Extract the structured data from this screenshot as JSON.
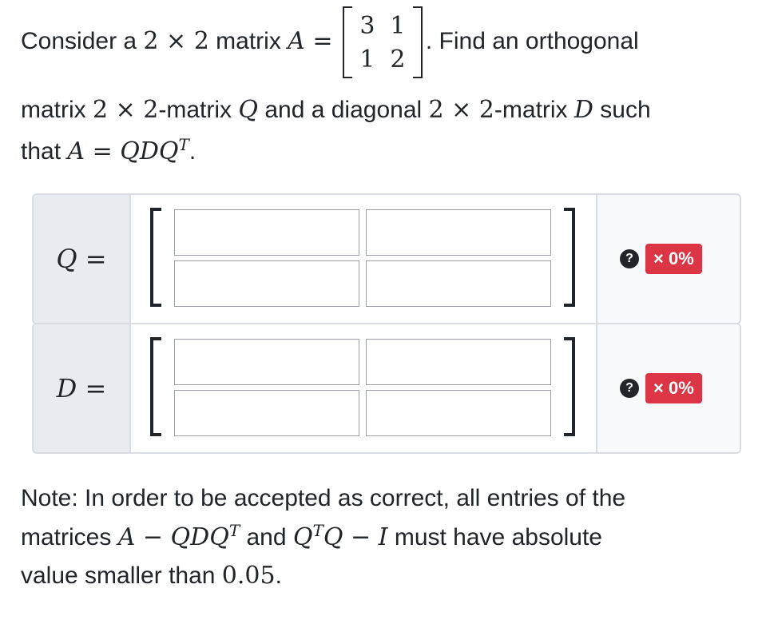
{
  "prompt": {
    "intro": "Consider a ",
    "dim1": "2 × 2",
    "matrix_word": " matrix ",
    "var_a": "A",
    "equals": " =",
    "matrix_a": [
      "3",
      "1",
      "1",
      "2"
    ],
    "find_text": ". Find an orthogonal",
    "line2_a": "matrix ",
    "line2_dim": "2 × 2",
    "line2_b": "-matrix ",
    "var_q": "Q",
    "line2_c": " and a diagonal ",
    "line2_dim2": "2 × 2",
    "line2_d": "-matrix ",
    "var_d": "D",
    "line2_e": " such",
    "line3_a": "that ",
    "line3_eq": "A = QDQ",
    "line3_sup": "T",
    "line3_end": "."
  },
  "answer_rows": [
    {
      "label": "Q =",
      "cells": [
        "",
        "",
        "",
        ""
      ],
      "help": "?",
      "score": "× 0%"
    },
    {
      "label": "D =",
      "cells": [
        "",
        "",
        "",
        ""
      ],
      "help": "?",
      "score": "× 0%"
    }
  ],
  "note": {
    "part1": "Note: In order to be accepted as correct, all entries of the",
    "part2a": "matrices ",
    "expr1": "A − QDQ",
    "expr1_sup": "T",
    "part2b": " and ",
    "expr2a": "Q",
    "expr2_sup": "T",
    "expr2b": "Q − I",
    "part2c": " must have absolute",
    "part3a": "value smaller than ",
    "value": "0.05",
    "part3b": "."
  },
  "colors": {
    "score_badge": "#dc3545",
    "panel_label_bg": "#e9ecef",
    "panel_border": "#d9dde2"
  }
}
